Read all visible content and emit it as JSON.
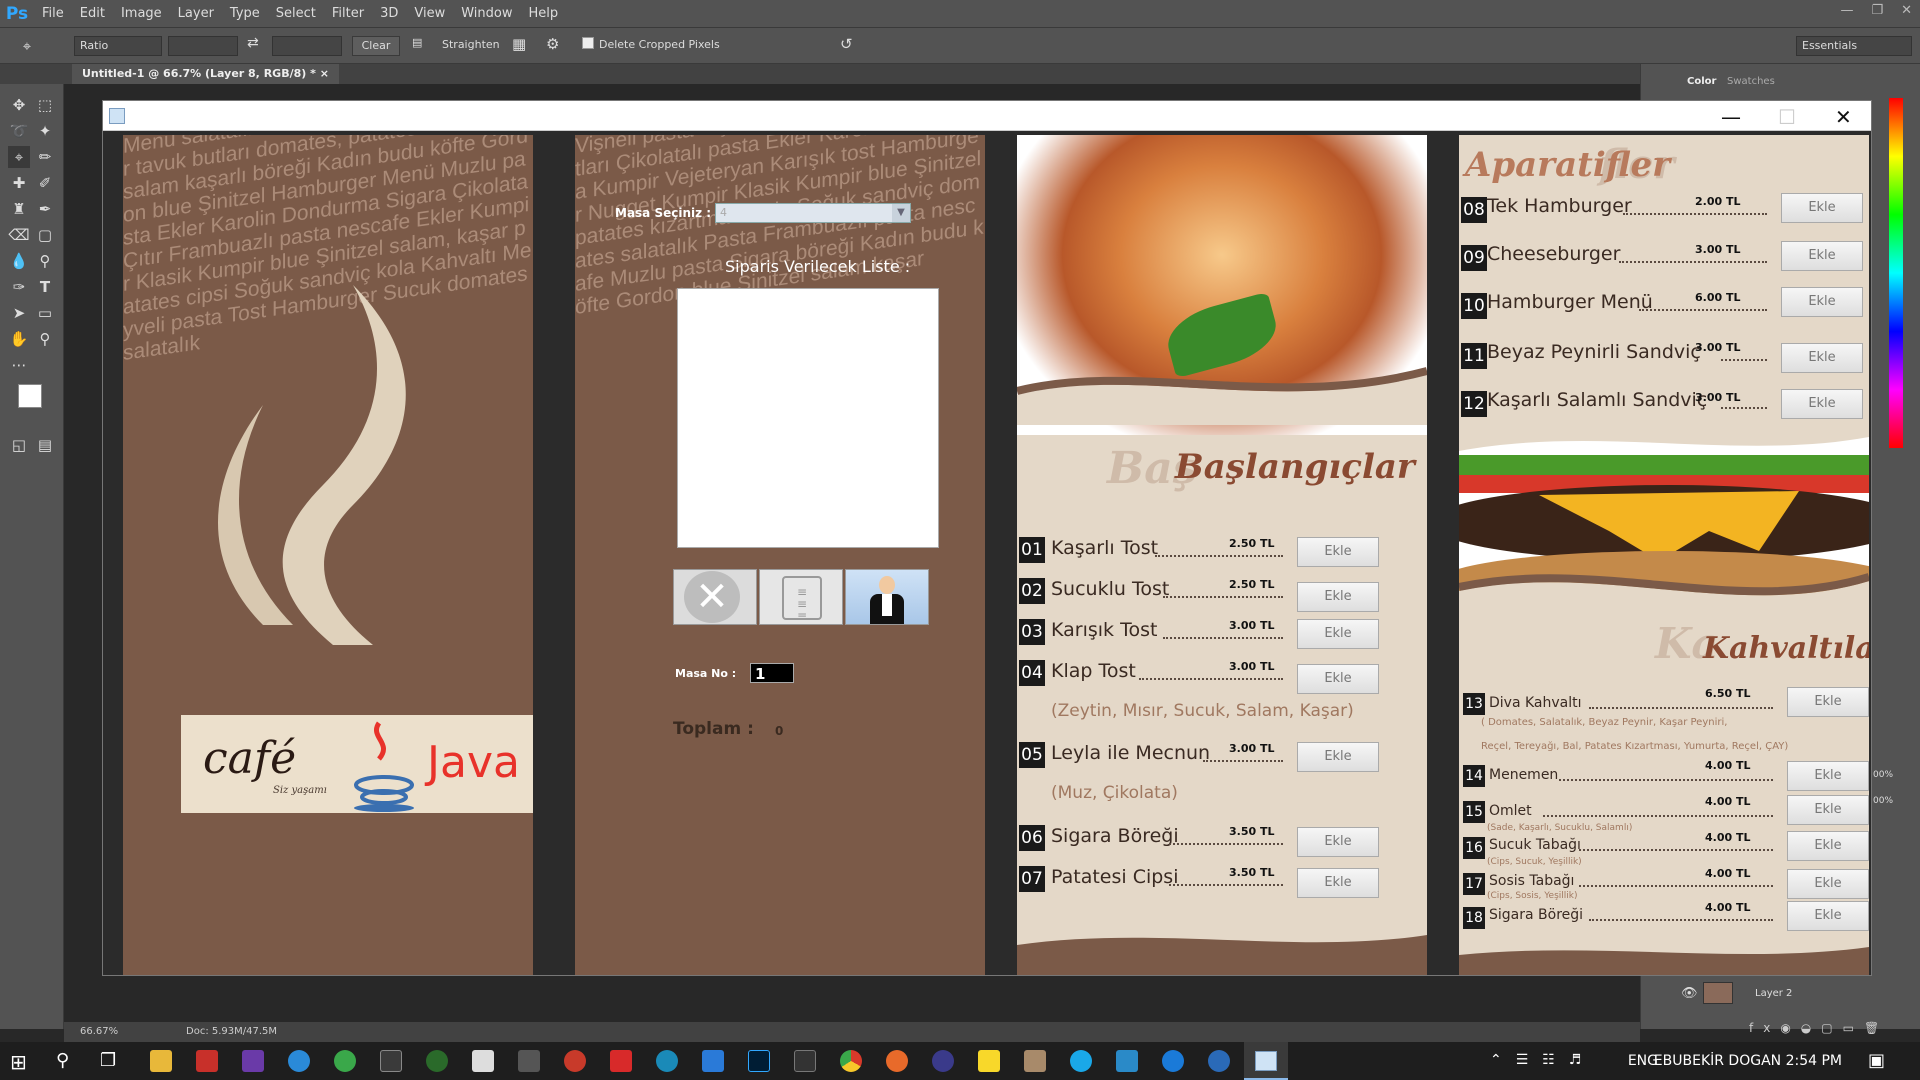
{
  "photoshop": {
    "logo": "Ps",
    "menu": [
      "File",
      "Edit",
      "Image",
      "Layer",
      "Type",
      "Select",
      "Filter",
      "3D",
      "View",
      "Window",
      "Help"
    ],
    "options": {
      "ratio": "Ratio",
      "clear_label": "Clear",
      "straighten_label": "Straighten",
      "delete_cropped": "Delete Cropped Pixels",
      "workspace": "Essentials"
    },
    "doc_tab": "Untitled-1 @ 66.7% (Layer 8, RGB/8) *",
    "panel_tabs": [
      "Color",
      "Swatches"
    ],
    "layer_name": "Layer 2",
    "opacity_a": "00%",
    "opacity_b": "00%",
    "status": {
      "zoom": "66.67%",
      "doc": "Doc: 5.93M/47.5M"
    }
  },
  "java_app": {
    "panel2": {
      "masa_secimi_label": "Masa Seçiniz :",
      "masa_secimi_value": "4",
      "siparis_label": "Siparis Verilecek Liste :",
      "masa_no_label": "Masa No :",
      "masa_no_value": "1",
      "toplam_label": "Toplam :",
      "toplam_value": "0"
    },
    "logo": {
      "cafe": "café",
      "tagline": "Siz yaşamı",
      "brand": "Java"
    },
    "baslangiclar": {
      "title": "Başlangıçlar",
      "items": [
        {
          "no": "01",
          "name": "Kaşarlı Tost",
          "price": "2.50 TL",
          "button": "Ekle"
        },
        {
          "no": "02",
          "name": "Sucuklu Tost",
          "price": "2.50 TL",
          "button": "Ekle"
        },
        {
          "no": "03",
          "name": "Karışık Tost",
          "price": "3.00 TL",
          "button": "Ekle"
        },
        {
          "no": "04",
          "name": "Klap Tost",
          "price": "3.00 TL",
          "button": "Ekle"
        },
        {
          "no": "05",
          "name": "Leyla ile Mecnun",
          "price": "3.00 TL",
          "button": "Ekle"
        },
        {
          "no": "06",
          "name": "Sigara Böreği",
          "price": "3.50 TL",
          "button": "Ekle"
        },
        {
          "no": "07",
          "name": "Patatesi Cipsi",
          "price": "3.50 TL",
          "button": "Ekle"
        }
      ],
      "note_04": "(Zeytin, Mısır, Sucuk, Salam, Kaşar)",
      "note_05": "(Muz, Çikolata)"
    },
    "aparatifler": {
      "title": "Aparatifler",
      "items": [
        {
          "no": "08",
          "name": "Tek Hamburger",
          "price": "2.00 TL",
          "button": "Ekle"
        },
        {
          "no": "09",
          "name": "Cheeseburger",
          "price": "3.00 TL",
          "button": "Ekle"
        },
        {
          "no": "10",
          "name": "Hamburger Menü",
          "price": "6.00 TL",
          "button": "Ekle"
        },
        {
          "no": "11",
          "name": "Beyaz Peynirli Sandviç",
          "price": "3.00 TL",
          "button": "Ekle"
        },
        {
          "no": "12",
          "name": "Kaşarlı Salamlı Sandviç",
          "price": "3.00 TL",
          "button": "Ekle"
        }
      ]
    },
    "kahvaltilar": {
      "title": "Kahvaltılar",
      "items": [
        {
          "no": "13",
          "name": "Diva Kahvaltı",
          "price": "6.50 TL",
          "button": "Ekle"
        },
        {
          "no": "14",
          "name": "Menemen",
          "price": "4.00 TL",
          "button": "Ekle"
        },
        {
          "no": "15",
          "name": "Omlet",
          "price": "4.00 TL",
          "button": "Ekle"
        },
        {
          "no": "16",
          "name": "Sucuk Tabağı",
          "price": "4.00 TL",
          "button": "Ekle"
        },
        {
          "no": "17",
          "name": "Sosis Tabağı",
          "price": "4.00 TL",
          "button": "Ekle"
        },
        {
          "no": "18",
          "name": "Sigara Böreği",
          "price": "4.00 TL",
          "button": "Ekle"
        }
      ],
      "note_13a": "( Domates, Salatalık, Beyaz Peynir, Kaşar Peyniri,",
      "note_13b": "Reçel, Tereyağı, Bal, Patates Kızartması, Yumurta, Reçel, ÇAY)",
      "note_15": "(Sade, Kaşarlı, Sucuklu, Salamlı)",
      "note_16": "(Cips, Sucuk, Yeşillik)",
      "note_17": "(Cips, Sosis, Yeşillik)"
    }
  },
  "taskbar": {
    "lang": "ENG",
    "user_time": "EBUBEKİR DOGAN 2:54 PM"
  },
  "colors": {
    "brown": "#7b5a48",
    "cream": "#e4d8c8",
    "title": "#8a4a32",
    "ps_panel": "#535353"
  }
}
